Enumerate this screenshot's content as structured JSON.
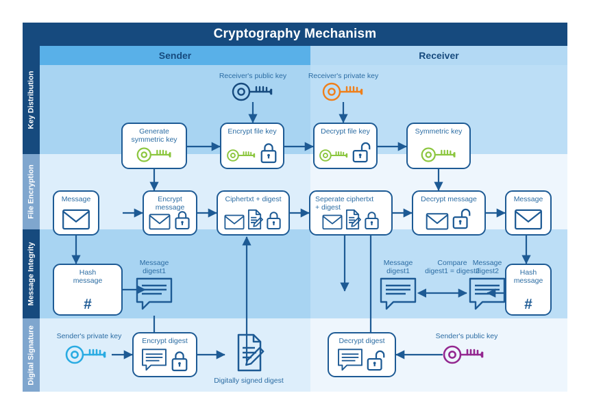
{
  "header": {
    "title": "Cryptography Mechanism"
  },
  "columns": {
    "sender": "Sender",
    "receiver": "Receiver"
  },
  "rows": [
    {
      "label": "Key Distribution"
    },
    {
      "label": "File Encryption"
    },
    {
      "label": "Message Integrity"
    },
    {
      "label": "Digital Signature"
    }
  ],
  "key_distribution": {
    "receiver_public_key_caption": "Receiver's public key",
    "receiver_private_key_caption": "Receiver's private key",
    "nodes": {
      "generate_symmetric_key": "Generate\nsymmetric key",
      "generate_symmetric_key_l1": "Generate",
      "generate_symmetric_key_l2": "symmetric key",
      "encrypt_file_key": "Encrypt file key",
      "decrypt_file_key": "Decrypt file key",
      "symmetric_key": "Symmetric key"
    }
  },
  "file_encryption": {
    "nodes": {
      "message_in": "Message",
      "encrypt_message": "Encrypt message",
      "ciphertext_digest": "Ciphertxt + digest",
      "separate_l1": "Seperate ciphertxt",
      "separate_l2": "+ digest",
      "decrypt_message": "Decrypt message",
      "message_out": "Message"
    }
  },
  "message_integrity": {
    "nodes": {
      "hash_message_l1": "Hash",
      "hash_message_l2": "message",
      "hash_glyph": "#",
      "hash_message_r_l1": "Hash",
      "hash_message_r_l2": "message"
    },
    "captions": {
      "message_digest1_sender_l1": "Message",
      "message_digest1_sender_l2": "digest1",
      "message_digest1_recv_l1": "Message",
      "message_digest1_recv_l2": "digest1",
      "message_digest2_l1": "Message",
      "message_digest2_l2": "digest2",
      "compare_l1": "Compare",
      "compare_l2": "digest1 = digest2"
    }
  },
  "digital_signature": {
    "sender_private_key_caption": "Sender's private key",
    "sender_public_key_caption": "Sender's public key",
    "signed_digest_caption": "Digitally signed digest",
    "nodes": {
      "encrypt_digest": "Encrypt digest",
      "decrypt_digest": "Decrypt digest"
    }
  },
  "colors": {
    "header_navy": "#164a7e",
    "sender_band": "#59b0e8",
    "receiver_band": "#b3d9f4",
    "stroke_navy": "#1d5a94",
    "label_blue": "#2b6ca3",
    "key_green": "#8cc63f",
    "key_orange": "#ef7f1a",
    "key_navy": "#164a7e",
    "key_cyan": "#29abe2",
    "key_purple": "#93278f"
  }
}
